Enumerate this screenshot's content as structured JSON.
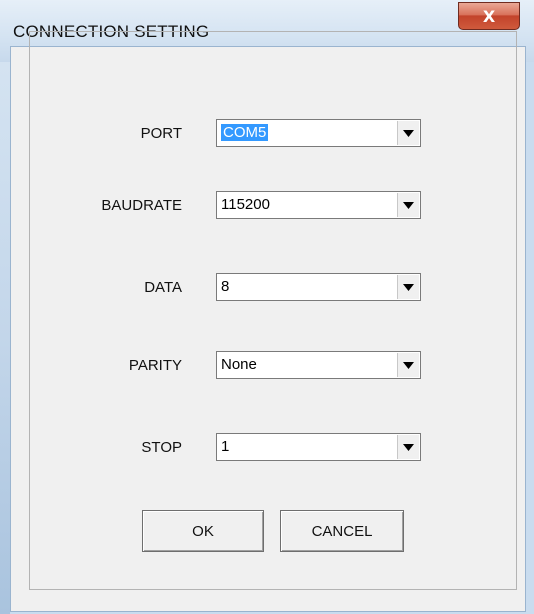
{
  "window": {
    "title": "CONNECTION SETTING",
    "close_label": "X"
  },
  "form": {
    "port": {
      "label": "PORT",
      "value": "COM5"
    },
    "baudrate": {
      "label": "BAUDRATE",
      "value": "115200"
    },
    "data": {
      "label": "DATA",
      "value": "8"
    },
    "parity": {
      "label": "PARITY",
      "value": "None"
    },
    "stop": {
      "label": "STOP",
      "value": "1"
    }
  },
  "buttons": {
    "ok": "OK",
    "cancel": "CANCEL"
  },
  "icons": {
    "dropdown": "chevron-down-icon",
    "close": "close-icon"
  },
  "colors": {
    "selection": "#3399ff",
    "close_button": "#c2432b"
  }
}
